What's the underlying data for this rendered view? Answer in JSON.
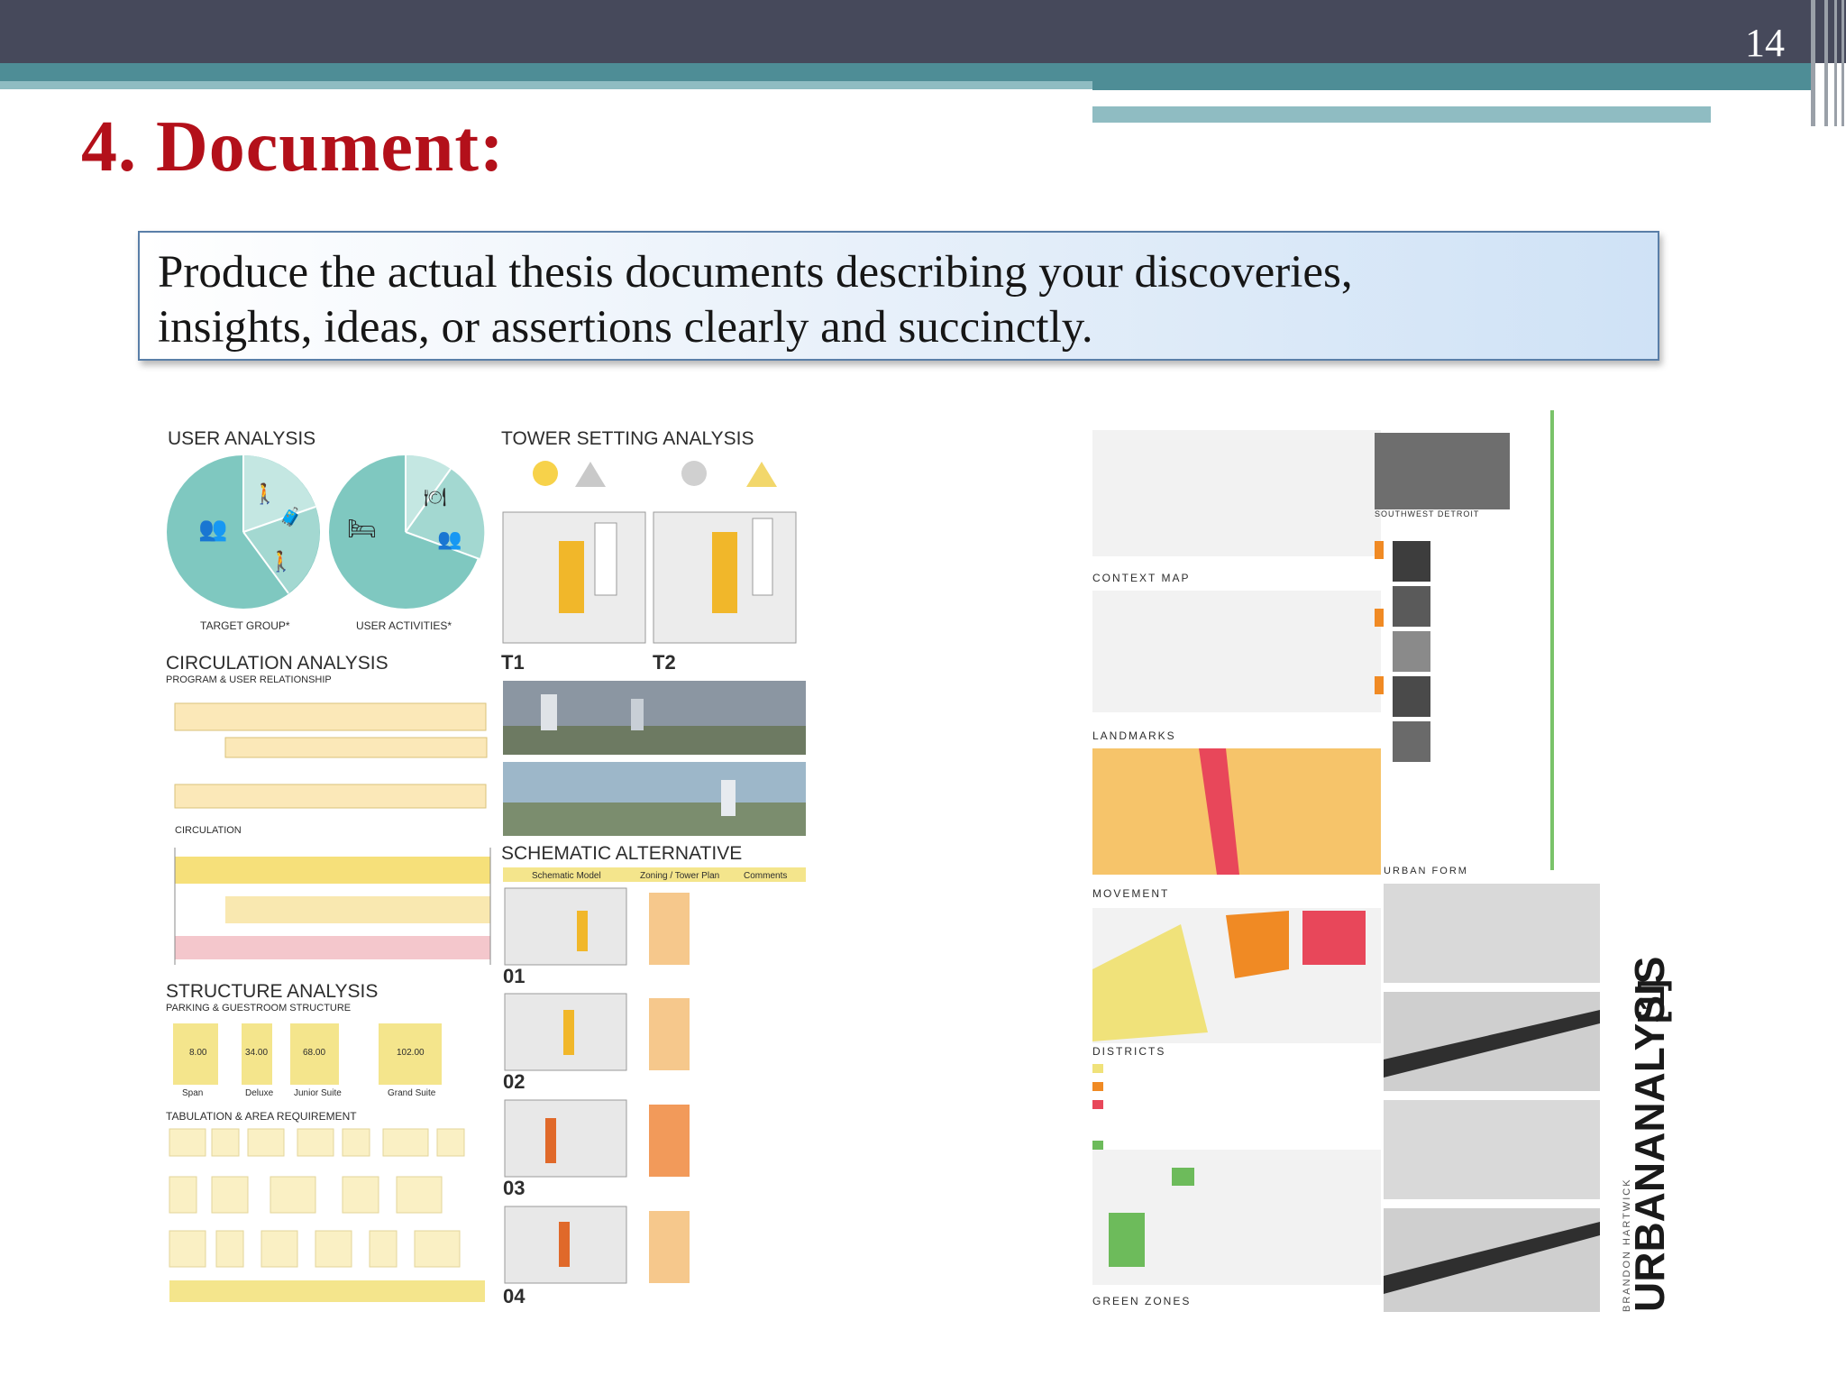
{
  "slide": {
    "page_number": "14",
    "title": "4. Document:",
    "callout_line1": "Produce the actual thesis documents describing your discoveries,",
    "callout_line2": "insights, ideas, or assertions clearly and succinctly."
  },
  "poster_left": {
    "user_analysis": "USER ANALYSIS",
    "target_group": "TARGET GROUP*",
    "user_activities": "USER ACTIVITIES*",
    "circulation_analysis": "CIRCULATION ANALYSIS",
    "program_relationship": "PROGRAM & USER RELATIONSHIP",
    "circulation": "CIRCULATION",
    "structure_analysis": "STRUCTURE ANALYSIS",
    "parking_structure": "PARKING & GUESTROOM STRUCTURE",
    "tabulation": "TABULATION & AREA REQUIREMENT",
    "tower_setting": "TOWER SETTING ANALYSIS",
    "t1": "T1",
    "t2": "T2",
    "schematic": "SCHEMATIC ALTERNATIVE",
    "schematic_model": "Schematic Model",
    "zoning": "Zoning / Tower Plan",
    "comments": "Comments",
    "alt1": "01",
    "alt2": "02",
    "alt3": "03",
    "alt4": "04",
    "dim1": "8.00",
    "dim2": "34.00",
    "dim3": "68.00",
    "dim4": "102.00",
    "room1": "Span",
    "room2": "Deluxe",
    "room3": "Junior Suite",
    "room4": "Grand Suite"
  },
  "poster_right": {
    "title": "URBANANALYSIS",
    "bracket": "[1]",
    "author": "BRANDON HARTWICK",
    "context_map": "CONTEXT MAP",
    "landmarks": "LANDMARKS",
    "movement": "MOVEMENT",
    "districts": "DISTRICTS",
    "green_zones": "GREEN ZONES",
    "urban_form": "URBAN FORM",
    "southwest_detroit": "SOUTHWEST DETROIT"
  },
  "colors": {
    "title_red": "#b3101a",
    "header_dark": "#46495b",
    "header_teal": "#4e8d96",
    "chart_teal": "#7fc8c0",
    "accent_yellow": "#f0e27a",
    "accent_orange": "#f08a24",
    "accent_red": "#e8475a"
  }
}
